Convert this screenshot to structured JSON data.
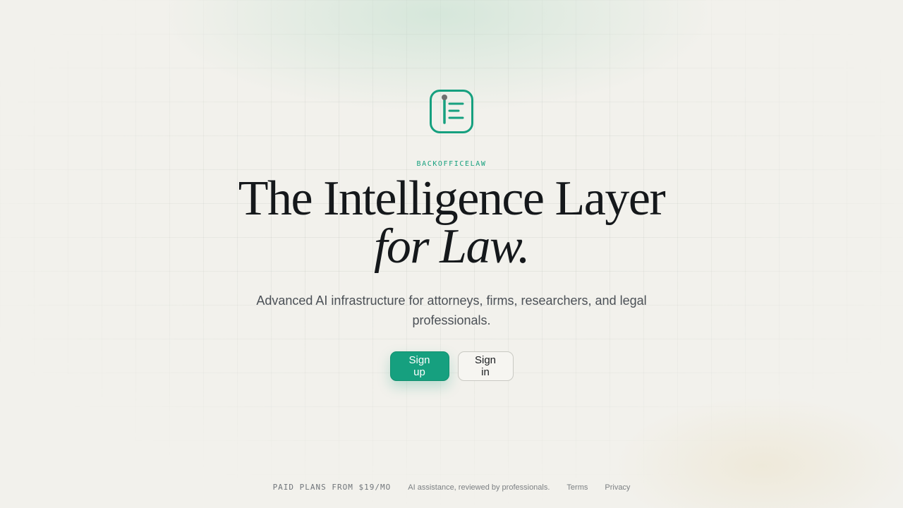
{
  "brand": {
    "logo_icon": "document-lines-icon",
    "name": "BACKOFFICELAW",
    "accent_color": "#16a07f"
  },
  "hero": {
    "headline_main": "The Intelligence Layer ",
    "headline_italic": "for Law.",
    "subtitle": "Advanced AI infrastructure for attorneys, firms, researchers, and legal professionals."
  },
  "actions": {
    "signup_label": "Sign up",
    "signin_label": "Sign in"
  },
  "footer": {
    "pricing": "PAID PLANS FROM $19/MO",
    "tagline": "AI assistance, reviewed by professionals.",
    "terms_label": "Terms",
    "privacy_label": "Privacy"
  }
}
